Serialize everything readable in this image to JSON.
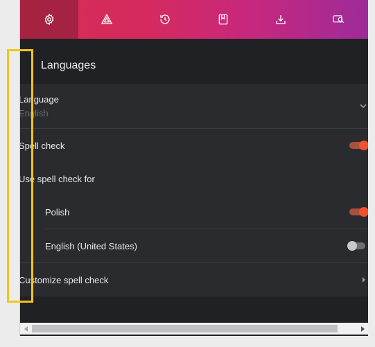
{
  "nav": {
    "tabs": [
      {
        "icon": "gear-icon",
        "active": true
      },
      {
        "icon": "appearance-icon",
        "active": false
      },
      {
        "icon": "history-icon",
        "active": false
      },
      {
        "icon": "bookmark-icon",
        "active": false
      },
      {
        "icon": "download-icon",
        "active": false
      },
      {
        "icon": "search-engine-icon",
        "active": false
      }
    ]
  },
  "section": {
    "title": "Languages"
  },
  "settings": {
    "language_label": "Language",
    "language_value": "English",
    "spell_check_label": "Spell check",
    "spell_check_on": true,
    "use_spell_check_for_label": "Use spell check for",
    "languages": [
      {
        "label": "Polish",
        "enabled": true
      },
      {
        "label": "English (United States)",
        "enabled": false
      }
    ],
    "customize_label": "Customize spell check"
  },
  "colors": {
    "accent": "#f2512b",
    "highlight": "#f5c518"
  }
}
